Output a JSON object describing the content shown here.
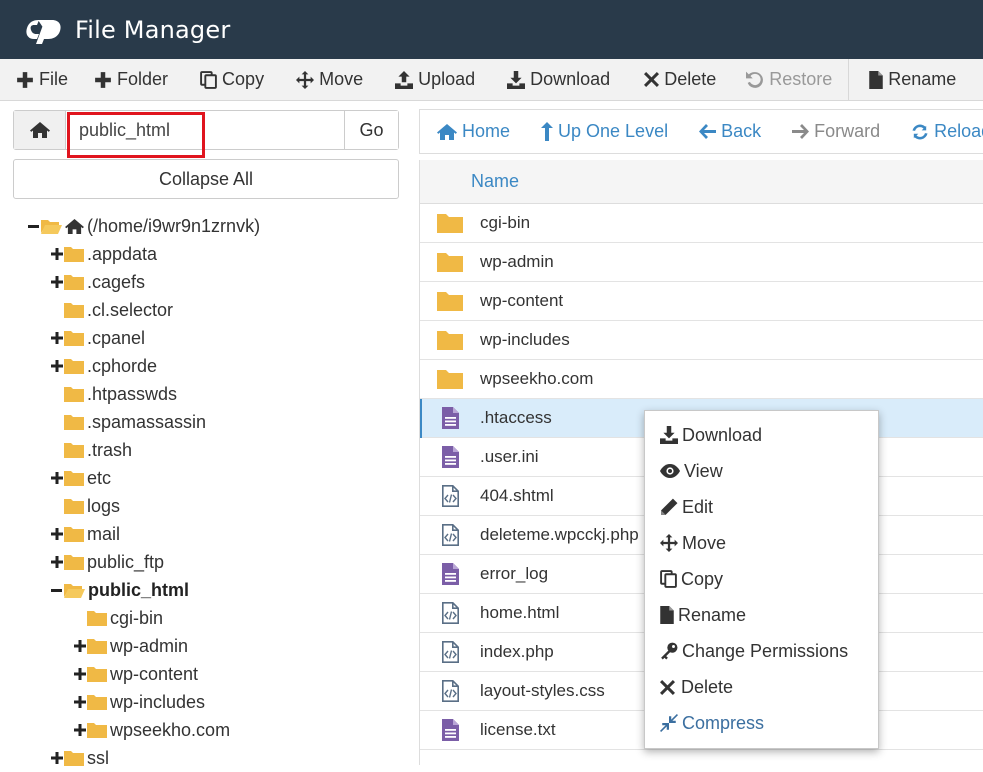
{
  "app": {
    "title": "File Manager"
  },
  "toolbar": {
    "file": "File",
    "folder": "Folder",
    "copy": "Copy",
    "move": "Move",
    "upload": "Upload",
    "download": "Download",
    "delete": "Delete",
    "restore": "Restore",
    "rename": "Rename"
  },
  "path_bar": {
    "value": "public_html",
    "go": "Go"
  },
  "collapse_all": "Collapse All",
  "tree": {
    "root": "(/home/i9wr9n1zrnvk)",
    "appdata": ".appdata",
    "cagefs": ".cagefs",
    "cl_selector": ".cl.selector",
    "cpanel": ".cpanel",
    "cphorde": ".cphorde",
    "htpasswds": ".htpasswds",
    "spamassassin": ".spamassassin",
    "trash": ".trash",
    "etc": "etc",
    "logs": "logs",
    "mail": "mail",
    "public_ftp": "public_ftp",
    "public_html": "public_html",
    "cgi_bin": "cgi-bin",
    "wp_admin": "wp-admin",
    "wp_content": "wp-content",
    "wp_includes": "wp-includes",
    "wpseekho": "wpseekho.com",
    "ssl": "ssl"
  },
  "nav": {
    "home": "Home",
    "up_one_level": "Up One Level",
    "back": "Back",
    "forward": "Forward",
    "reload": "Reload"
  },
  "table": {
    "col_name": "Name",
    "files": [
      {
        "name": "cgi-bin",
        "icon": "folder-icon"
      },
      {
        "name": "wp-admin",
        "icon": "folder-icon"
      },
      {
        "name": "wp-content",
        "icon": "folder-icon"
      },
      {
        "name": "wp-includes",
        "icon": "folder-icon"
      },
      {
        "name": "wpseekho.com",
        "icon": "folder-icon"
      },
      {
        "name": ".htaccess",
        "icon": "text-file-icon",
        "selected": true
      },
      {
        "name": ".user.ini",
        "icon": "text-file-icon"
      },
      {
        "name": "404.shtml",
        "icon": "code-file-icon"
      },
      {
        "name": "deleteme.wpcckj.php",
        "icon": "code-file-icon"
      },
      {
        "name": "error_log",
        "icon": "text-file-icon"
      },
      {
        "name": "home.html",
        "icon": "code-file-icon"
      },
      {
        "name": "index.php",
        "icon": "code-file-icon"
      },
      {
        "name": "layout-styles.css",
        "icon": "code-file-icon"
      },
      {
        "name": "license.txt",
        "icon": "text-file-icon"
      }
    ]
  },
  "context_menu": {
    "download": "Download",
    "view": "View",
    "edit": "Edit",
    "move": "Move",
    "copy": "Copy",
    "rename": "Rename",
    "change_permissions": "Change Permissions",
    "delete": "Delete",
    "compress": "Compress"
  },
  "colors": {
    "header_bg": "#293a4a",
    "link_blue": "#3b88c4",
    "folder_yellow": "#f0b945",
    "file_purple": "#7b5ea7",
    "highlight_red": "#e0141e",
    "selected_row": "#d9ecfa"
  }
}
